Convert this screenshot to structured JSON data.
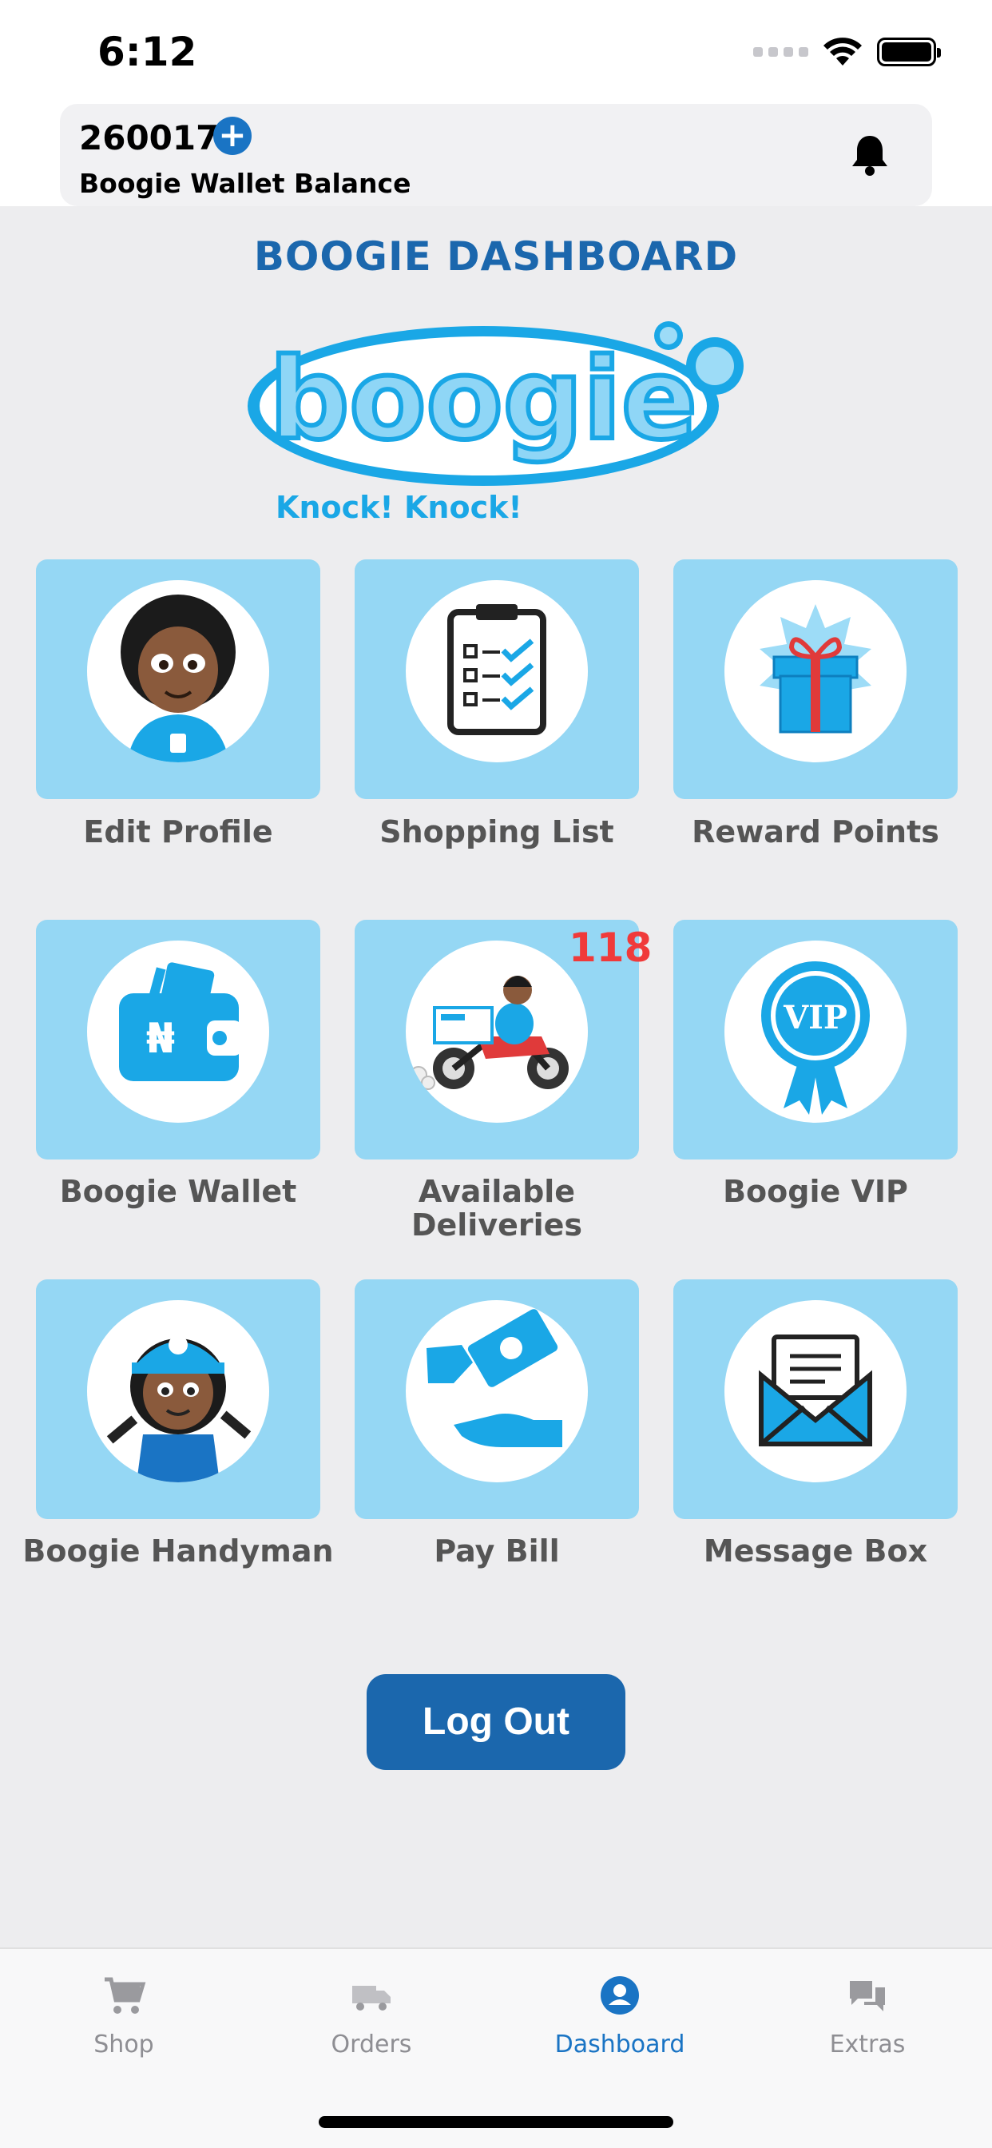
{
  "status_bar": {
    "time": "6:12"
  },
  "wallet": {
    "amount": "260017",
    "label": "Boogie Wallet Balance",
    "add_symbol": "+"
  },
  "dashboard": {
    "title": "BOOGIE DASHBOARD",
    "logo": {
      "wordmark": "boogie",
      "tagline": "Knock! Knock!"
    }
  },
  "tiles": [
    {
      "label": "Edit Profile",
      "icon": "boy-avatar-icon"
    },
    {
      "label": "Shopping List",
      "icon": "clipboard-checklist-icon"
    },
    {
      "label": "Reward Points",
      "icon": "gift-box-icon"
    },
    {
      "label": "Boogie Wallet",
      "icon": "wallet-icon",
      "currency_symbol": "₦"
    },
    {
      "label": "Available Deliveries",
      "icon": "delivery-motorbike-icon",
      "badge": "118"
    },
    {
      "label": "Boogie VIP",
      "icon": "vip-ribbon-icon",
      "badge_text": "VIP"
    },
    {
      "label": "Boogie Handyman",
      "icon": "handyman-icon"
    },
    {
      "label": "Pay Bill",
      "icon": "pay-bill-hand-icon"
    },
    {
      "label": "Message Box",
      "icon": "envelope-icon"
    }
  ],
  "logout_label": "Log Out",
  "tab_bar": [
    {
      "label": "Shop",
      "icon": "cart-icon",
      "active": false
    },
    {
      "label": "Orders",
      "icon": "truck-icon",
      "active": false
    },
    {
      "label": "Dashboard",
      "icon": "person-circle-icon",
      "active": true
    },
    {
      "label": "Extras",
      "icon": "chat-bubbles-icon",
      "active": false
    }
  ],
  "colors": {
    "primary_blue": "#1b67ad",
    "accent_blue": "#1a74c4",
    "tile_blue": "#95d7f4",
    "icon_blue": "#1aa7e6",
    "badge_red": "#f03a3a",
    "background": "#ededef"
  }
}
